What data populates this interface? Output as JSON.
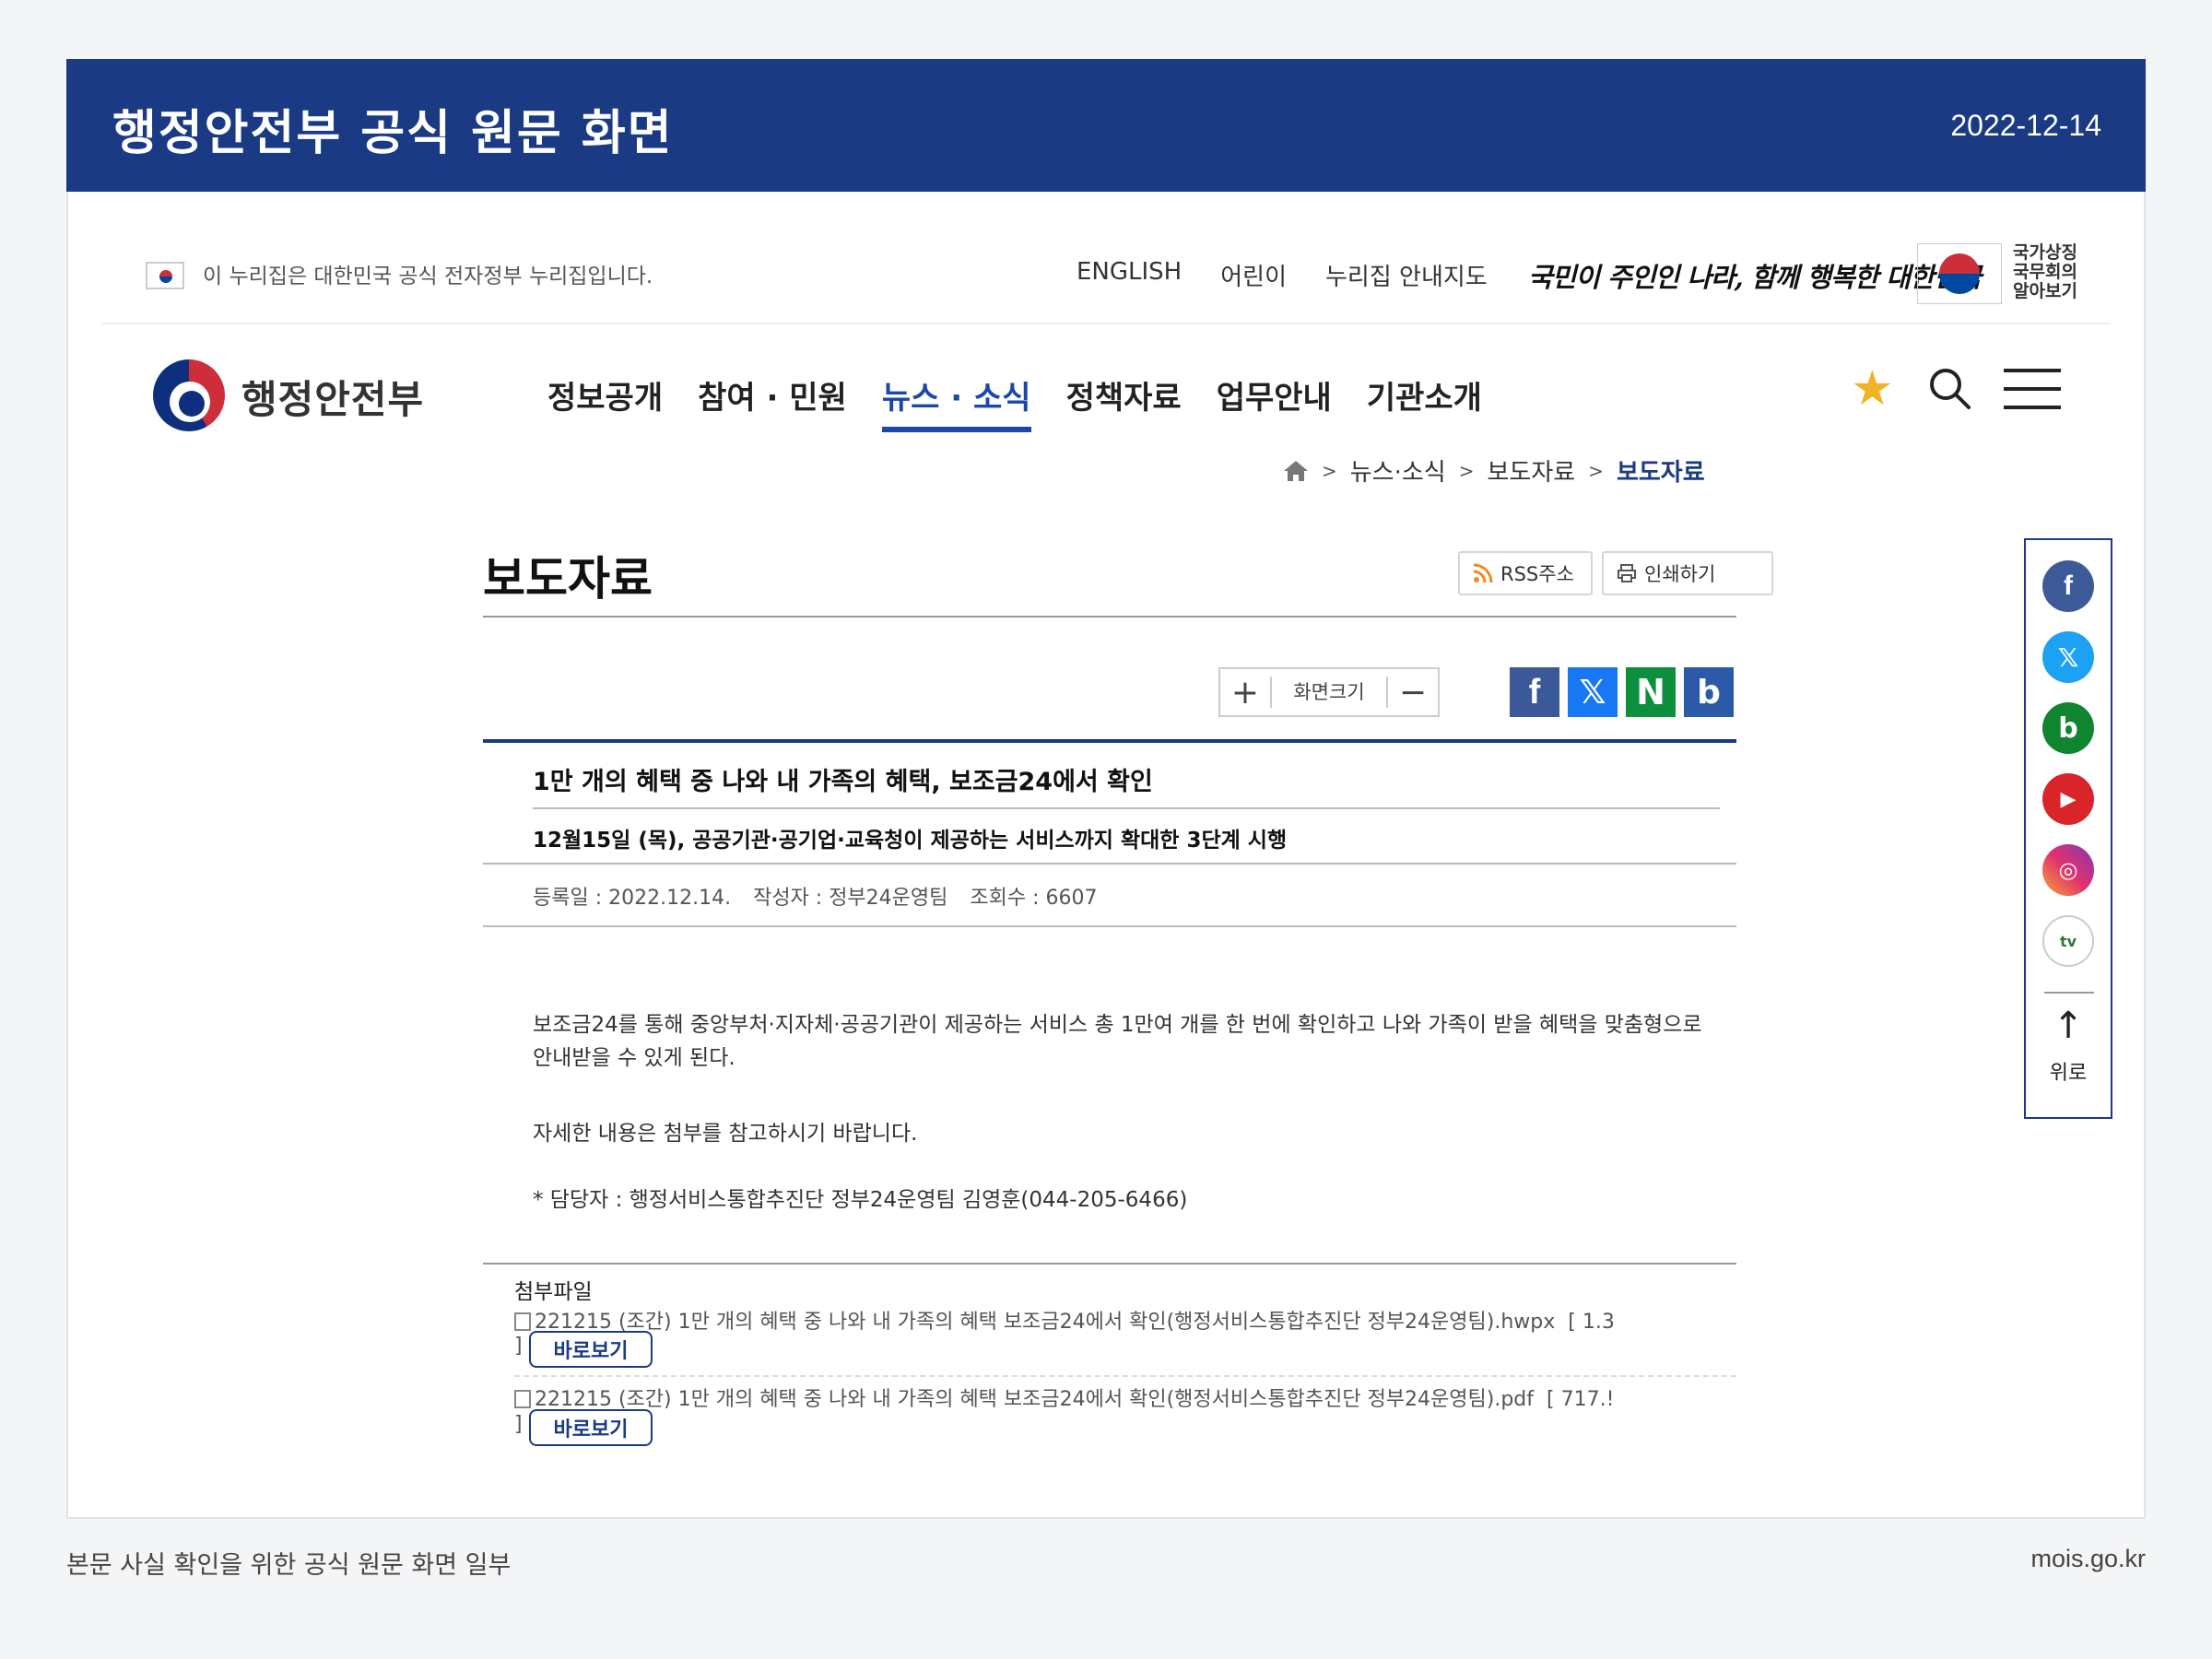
{
  "banner": {
    "title": "행정안전부 공식 원문 화면",
    "date": "2022-12-14"
  },
  "util_bar": {
    "gov_notice": "이 누리집은 대한민국 공식 전자정부 누리집입니다.",
    "links": [
      "ENGLISH",
      "어린이",
      "누리집 안내지도"
    ],
    "slogan": "국민이 주인인 나라, 함께 행복한 대한민국",
    "symbol_lines": [
      "국가상징",
      "국무회의",
      "알아보기"
    ]
  },
  "header": {
    "logo": "행정안전부",
    "nav": [
      {
        "label": "정보공개",
        "active": false
      },
      {
        "label": "참여 · 민원",
        "active": false
      },
      {
        "label": "뉴스 · 소식",
        "active": true
      },
      {
        "label": "정책자료",
        "active": false
      },
      {
        "label": "업무안내",
        "active": false
      },
      {
        "label": "기관소개",
        "active": false
      }
    ],
    "icons": [
      "star-icon",
      "search-icon",
      "menu-icon"
    ]
  },
  "breadcrumb": [
    "뉴스·소식",
    "보도자료",
    "보도자료"
  ],
  "page": {
    "title": "보도자료",
    "rss_label": "RSS주소",
    "print_label": "인쇄하기",
    "fontsize_label": "화면크기",
    "fontsize_plus": "+",
    "fontsize_minus": "−"
  },
  "share": {
    "facebook": "f",
    "x": "𝕏",
    "naver": "N",
    "band": "b"
  },
  "article": {
    "title": "1만 개의 혜택 중 나와 내 가족의 혜택, 보조금24에서 확인",
    "subtitle": "12월15일 (목), 공공기관·공기업·교육청이 제공하는 서비스까지 확대한 3단계 시행",
    "registered": "등록일 : 2022.12.14.",
    "author": "작성자 : 정부24운영팀",
    "views": "조회수 : 6607",
    "body_1": "보조금24를 통해 중앙부처·지자체·공공기관이 제공하는 서비스 총 1만여 개를 한 번에 확인하고 나와 가족이 받을 혜택을 맞춤형으로 안내받을 수 있게 된다.",
    "body_2": "자세한 내용은 첨부를 참고하시기 바랍니다.",
    "body_3": "* 담당자 : 행정서비스통합추진단 정부24운영팀 김영훈(044-205-6466)"
  },
  "attachments": {
    "label": "첨부파일",
    "files": [
      {
        "name": "221215 (조간) 1만 개의 혜택 중 나와 내 가족의 혜택 보조금24에서 확인(행정서비스통합추진단 정부24운영팀).hwpx",
        "size": "[ 1.3",
        "close": "]",
        "view": "바로보기"
      },
      {
        "name": "221215 (조간) 1만 개의 혜택 중 나와 내 가족의 혜택 보조금24에서 확인(행정서비스통합추진단 정부24운영팀).pdf",
        "size": "[ 717.!",
        "close": "]",
        "view": "바로보기"
      }
    ]
  },
  "sidebar": {
    "sns": {
      "facebook": "f",
      "x": "𝕏",
      "blog": "b",
      "youtube": "▶",
      "instagram": "◎",
      "tv": "tv"
    },
    "top_arrow": "↑",
    "top_label": "위로"
  },
  "caption": {
    "text": "본문 사실 확인을 위한 공식 원문 화면 일부",
    "source": "mois.go.kr"
  },
  "colors": {
    "brand_navy": "#1a3a84",
    "accent_blue": "#1a47a8",
    "star": "#f0b323"
  }
}
